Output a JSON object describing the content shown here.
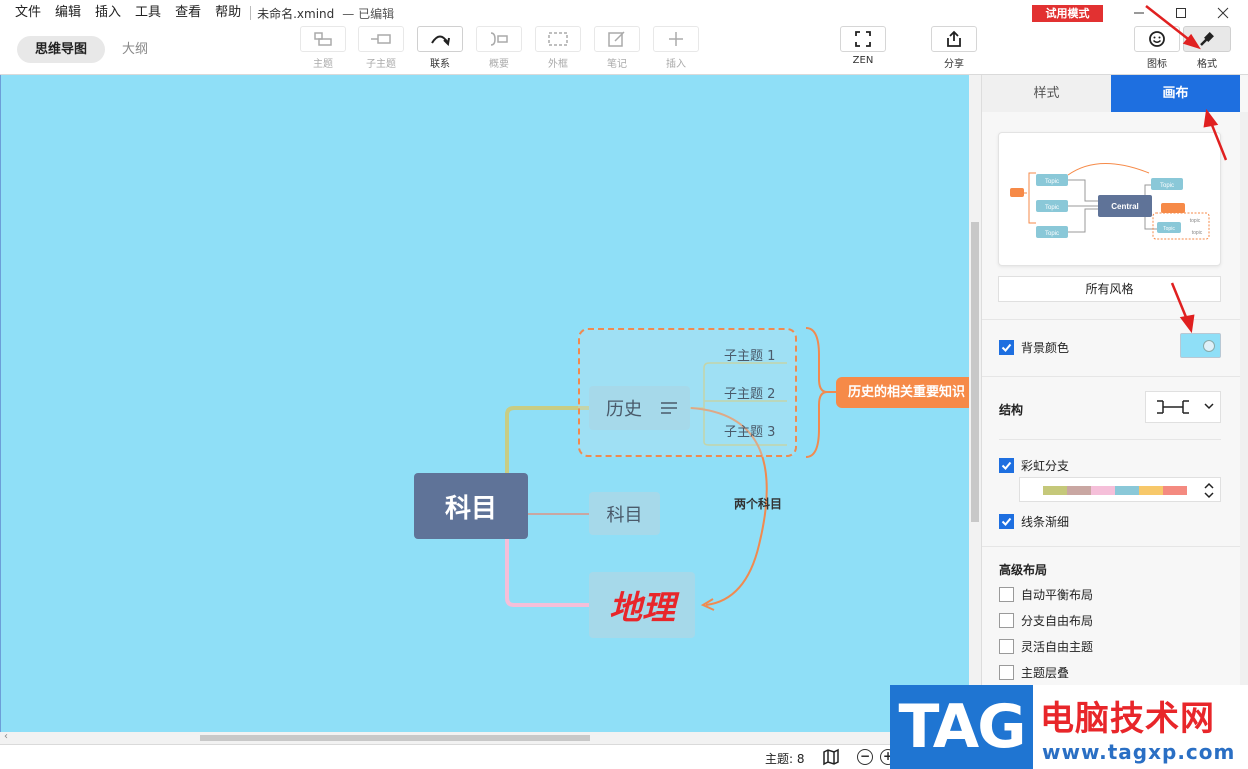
{
  "menu": [
    "文件",
    "编辑",
    "插入",
    "工具",
    "查看",
    "帮助"
  ],
  "window": {
    "filename": "未命名.xmind",
    "status": "— 已编辑",
    "trial_badge": "试用模式"
  },
  "view_tabs": {
    "mindmap": "思维导图",
    "outline": "大纲"
  },
  "toolbar": {
    "topic": "主题",
    "subtopic": "子主题",
    "relation": "联系",
    "summary": "概要",
    "boundary": "外框",
    "note": "笔记",
    "insert": "插入",
    "zen": "ZEN",
    "share": "分享",
    "icon": "图标",
    "format": "格式"
  },
  "mindmap": {
    "central": "科目",
    "topics": {
      "history": "历史",
      "subject": "科目",
      "geography": "地理"
    },
    "subtopics": [
      "子主题 1",
      "子主题 2",
      "子主题 3"
    ],
    "summary": "历史的相关重要知识",
    "relation": "两个科目"
  },
  "statusbar": {
    "topic_count": "主题: 8",
    "zoom_out": "−",
    "zoom_in": "+"
  },
  "panel": {
    "tab_style": "样式",
    "tab_canvas": "画布",
    "preview": {
      "central": "Central",
      "topic": "Topic",
      "subtopic": "topic"
    },
    "all_styles": "所有风格",
    "background_color": {
      "label": "背景颜色",
      "checked": true,
      "value": "#8fdff7"
    },
    "structure_label": "结构",
    "rainbow_branch": {
      "label": "彩虹分支",
      "checked": true,
      "colors": [
        "#c5c87a",
        "#c9a7a2",
        "#f5bfd9",
        "#8ac8d8",
        "#f7c86a",
        "#f48a80"
      ]
    },
    "line_taper": {
      "label": "线条渐细",
      "checked": true
    },
    "advanced_title": "高级布局",
    "advanced": [
      {
        "label": "自动平衡布局",
        "checked": false
      },
      {
        "label": "分支自由布局",
        "checked": false
      },
      {
        "label": "灵活自由主题",
        "checked": false
      },
      {
        "label": "主题层叠",
        "checked": false
      }
    ]
  },
  "watermark": {
    "logo": "TAG",
    "title": "电脑技术网",
    "url": "www.tagxp.com"
  },
  "colors": {
    "accent": "#1e6fe0",
    "canvas_bg": "#8fdff7",
    "central": "#5f7398",
    "summary": "#f68a48",
    "trial": "#e23131"
  }
}
